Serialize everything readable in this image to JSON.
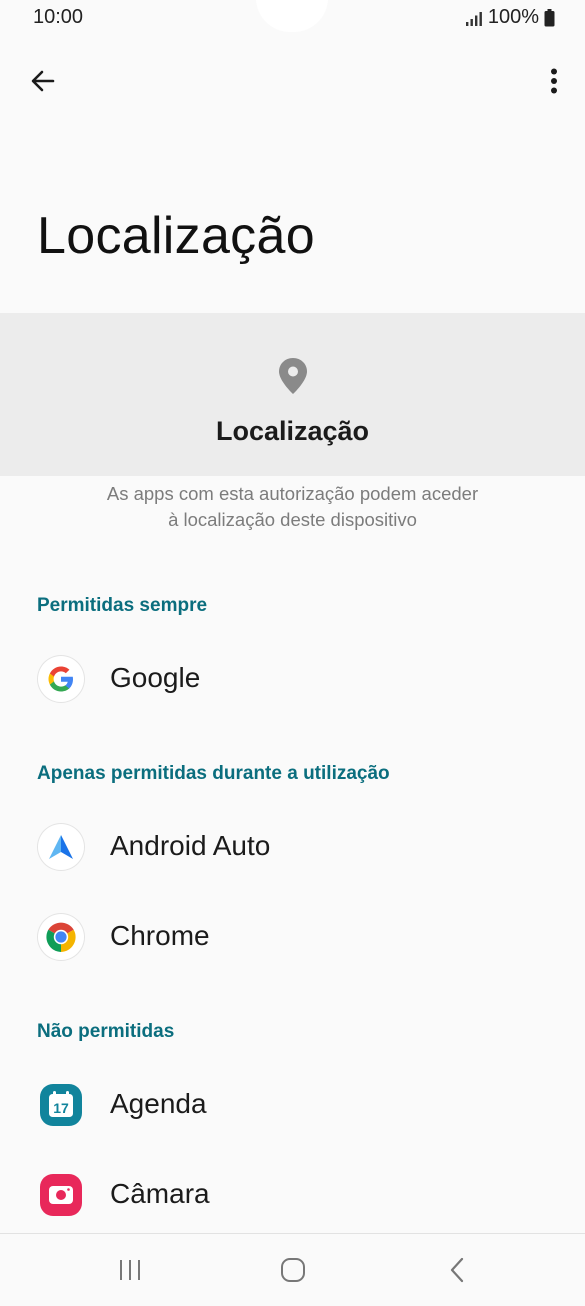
{
  "status_bar": {
    "time": "10:00",
    "battery_percent": "100%",
    "icons": [
      "signal-icon",
      "battery-icon"
    ]
  },
  "app_bar": {
    "back_icon": "arrow-back-icon",
    "menu_icon": "more-vert-icon"
  },
  "page": {
    "title": "Localização"
  },
  "permission_header": {
    "icon": "location-pin-icon",
    "title": "Localização",
    "description_line1": "As apps com esta autorização podem aceder",
    "description_line2": "à localização deste dispositivo"
  },
  "sections": [
    {
      "title": "Permitidas sempre",
      "apps": [
        {
          "label": "Google",
          "icon": "google-icon"
        }
      ]
    },
    {
      "title": "Apenas permitidas durante a utilização",
      "apps": [
        {
          "label": "Android Auto",
          "icon": "android-auto-icon"
        },
        {
          "label": "Chrome",
          "icon": "chrome-icon"
        }
      ]
    },
    {
      "title": "Não permitidas",
      "apps": [
        {
          "label": "Agenda",
          "icon": "calendar-icon",
          "badge": "17"
        },
        {
          "label": "Câmara",
          "icon": "camera-icon"
        }
      ]
    }
  ],
  "nav_bar": {
    "recents_icon": "recents-icon",
    "home_icon": "home-icon",
    "back_icon": "nav-back-icon"
  },
  "colors": {
    "accent": "#0b6e7e",
    "background": "#fafafa",
    "header_background": "#ececec"
  }
}
